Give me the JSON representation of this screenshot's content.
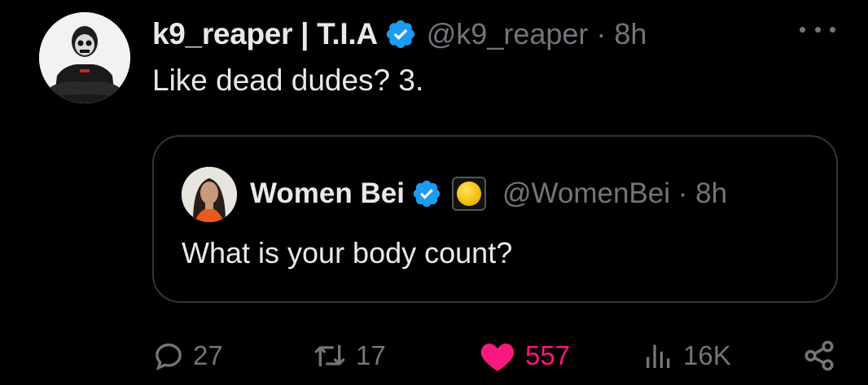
{
  "tweet": {
    "display_name": "k9_reaper | T.I.A",
    "handle_time": "@k9_reaper · 8h",
    "text": "Like dead dudes? 3."
  },
  "quote": {
    "display_name": "Women Bei",
    "handle_time": "@WomenBei · 8h",
    "text": "What is your body count?"
  },
  "actions": {
    "replies": "27",
    "retweets": "17",
    "likes": "557",
    "views": "16K"
  },
  "colors": {
    "background": "#000000",
    "primary_text": "#e7e9ea",
    "secondary_text": "#71767b",
    "verified_blue": "#1d9bf0",
    "like_pink": "#f91880",
    "border": "#333639"
  },
  "icons": [
    "verified-badge-icon",
    "more-icon",
    "reply-icon",
    "retweet-icon",
    "like-icon",
    "views-icon",
    "share-icon",
    "affiliate-badge-icon"
  ]
}
